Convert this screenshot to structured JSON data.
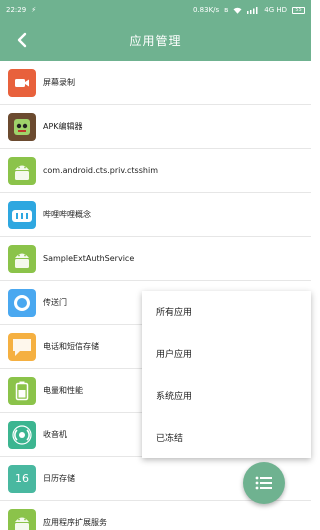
{
  "status_bar": {
    "time": "22:29",
    "network_speed": "0.83K/s",
    "network_label": "4G HD",
    "battery": "55"
  },
  "header": {
    "title": "应用管理"
  },
  "apps": [
    {
      "label": "屏幕录制",
      "icon": "video-camera-icon",
      "color": "#e8613c"
    },
    {
      "label": "APK编辑器",
      "icon": "apk-editor-icon",
      "color": "#6b4a2f"
    },
    {
      "label": "com.android.cts.priv.ctsshim",
      "icon": "android-icon",
      "color": "#8bc34a"
    },
    {
      "label": "哔哩哔哩概念",
      "icon": "bilibili-icon",
      "color": "#2ea7e0"
    },
    {
      "label": "SampleExtAuthService",
      "icon": "android-icon",
      "color": "#8bc34a"
    },
    {
      "label": "传送门",
      "icon": "portal-icon",
      "color": "#4aa8f0"
    },
    {
      "label": "电话和短信存储",
      "icon": "message-icon",
      "color": "#f5b041"
    },
    {
      "label": "电量和性能",
      "icon": "battery-icon",
      "color": "#8bc34a"
    },
    {
      "label": "收音机",
      "icon": "radio-icon",
      "color": "#3cb590"
    },
    {
      "label": "日历存储",
      "icon": "calendar-icon",
      "color": "#49b8a0",
      "day": "16"
    },
    {
      "label": "应用程序扩展服务",
      "icon": "android-icon",
      "color": "#8bc34a"
    }
  ],
  "filter_menu": {
    "items": [
      "所有应用",
      "用户应用",
      "系统应用",
      "已冻结"
    ]
  },
  "colors": {
    "primary": "#6fb290"
  }
}
